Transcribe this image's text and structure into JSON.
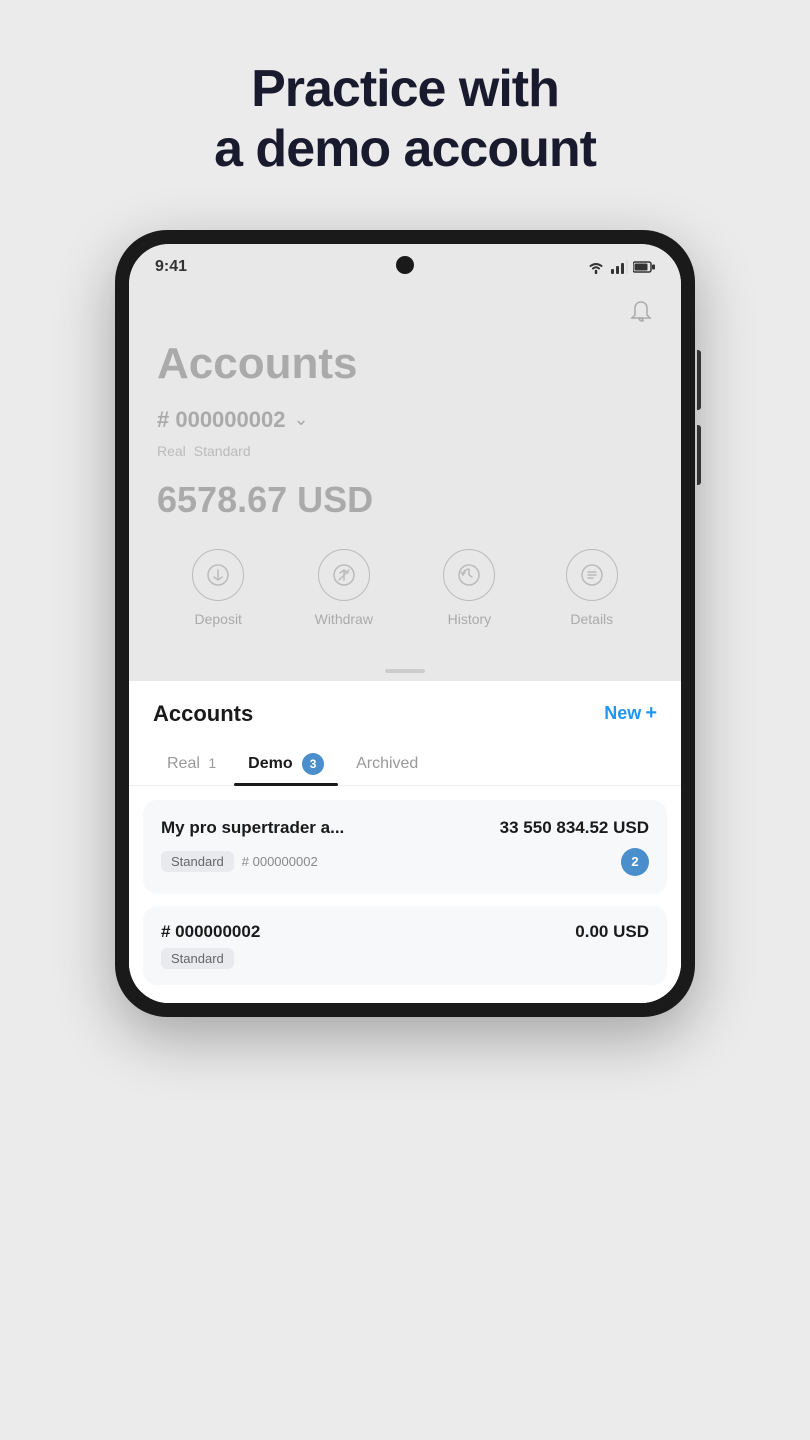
{
  "headline": {
    "line1": "Practice with",
    "line2": "a demo account"
  },
  "status_bar": {
    "time": "9:41",
    "wifi": "▼",
    "signal": "▲",
    "battery": "🔋"
  },
  "accounts_card": {
    "title": "Accounts",
    "account_number": "# 000000002",
    "tags": [
      "Real",
      "Standard"
    ],
    "balance": "6578.67 USD",
    "actions": [
      {
        "label": "Deposit",
        "icon": "↓"
      },
      {
        "label": "Withdraw",
        "icon": "↗"
      },
      {
        "label": "History",
        "icon": "↺"
      },
      {
        "label": "Details",
        "icon": "≡"
      }
    ]
  },
  "bottom_sheet": {
    "title": "Accounts",
    "new_button": "New",
    "new_icon": "+",
    "tabs": [
      {
        "label": "Real",
        "count": "1",
        "active": false
      },
      {
        "label": "Demo",
        "count": "3",
        "active": true
      },
      {
        "label": "Archived",
        "count": null,
        "active": false
      }
    ],
    "accounts": [
      {
        "name": "My pro supertrader a...",
        "balance": "33 550 834.52 USD",
        "tag": "Standard",
        "number": "# 000000002",
        "badge": "2"
      },
      {
        "name": null,
        "balance": "0.00 USD",
        "tag": "Standard",
        "number": "# 000000002",
        "badge": null
      }
    ]
  }
}
